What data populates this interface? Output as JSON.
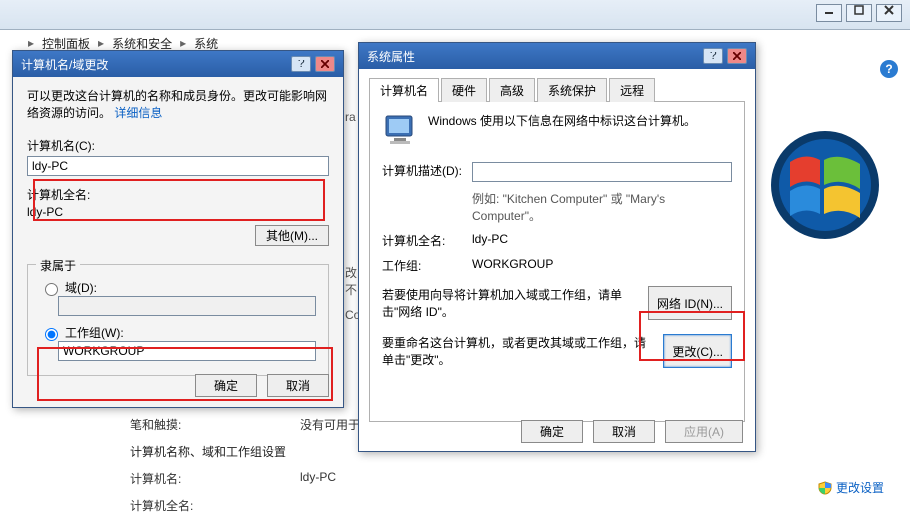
{
  "breadcrumb": {
    "p1": "控制面板",
    "p2": "系统和安全",
    "p3": "系统",
    "arrow": "▸"
  },
  "help_icon": "?",
  "bg": {
    "pen_label": "笔和触摸:",
    "pen_val": "没有可用于",
    "section": "计算机名称、域和工作组设置",
    "name_label": "计算机名:",
    "name_val": "ldy-PC",
    "full_label": "计算机全名:",
    "change_settings": "更改设置"
  },
  "dlgA": {
    "title": "计算机名/域更改",
    "intro": "可以更改这台计算机的名称和成员身份。更改可能影响网络资源的访问。",
    "link": "详细信息",
    "name_label": "计算机名(C):",
    "name_val": "ldy-PC",
    "full_label": "计算机全名:",
    "full_val": "ldy-PC",
    "more_btn": "其他(M)...",
    "group_legend": "隶属于",
    "radio_domain": "域(D):",
    "radio_wg": "工作组(W):",
    "wg_val": "WORKGROUP",
    "ok": "确定",
    "cancel": "取消"
  },
  "dlgB": {
    "title": "系统属性",
    "tabs": {
      "t1": "计算机名",
      "t2": "硬件",
      "t3": "高级",
      "t4": "系统保护",
      "t5": "远程"
    },
    "headline": "Windows 使用以下信息在网络中标识这台计算机。",
    "desc_label": "计算机描述(D):",
    "example": "例如: \"Kitchen Computer\" 或 \"Mary's Computer\"。",
    "full_label": "计算机全名:",
    "full_val": "ldy-PC",
    "wg_label": "工作组:",
    "wg_val": "WORKGROUP",
    "netid_text": "若要使用向导将计算机加入域或工作组，请单击\"网络 ID\"。",
    "netid_btn": "网络 ID(N)...",
    "change_text": "要重命名这台计算机，或者更改其域或工作组，请单击\"更改\"。",
    "change_btn": "更改(C)...",
    "ok": "确定",
    "cancel": "取消",
    "apply": "应用(A)"
  },
  "obs": {
    "a": "改不",
    "b": "Co",
    "c": "ra"
  }
}
